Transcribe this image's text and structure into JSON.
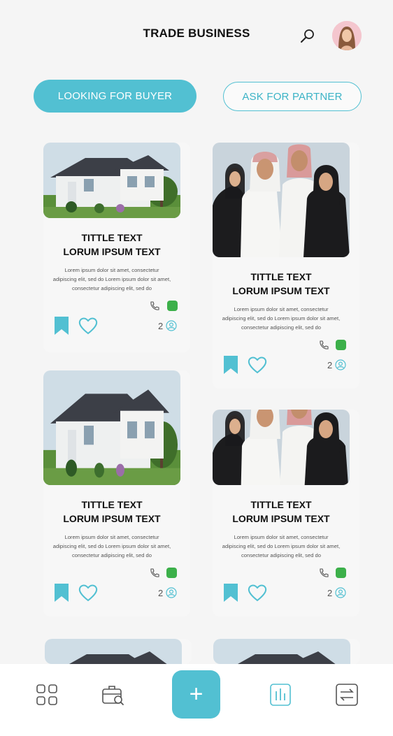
{
  "header": {
    "title": "TRADE BUSINESS",
    "search_icon": "search-icon",
    "avatar_icon": "user-avatar"
  },
  "tabs": [
    {
      "label": "LOOKING FOR BUYER",
      "active": true
    },
    {
      "label": "ASK FOR PARTNER",
      "active": false
    }
  ],
  "cards": [
    {
      "image": "house",
      "title_line1": "TITTLE TEXT",
      "title_line2": "LORUM IPSUM TEXT",
      "desc_line1": "Lorem ipsum dolor sit amet, consectetur",
      "desc_line2": "adipiscing elit, sed do Lorem ipsum dolor sit amet,",
      "desc_line3": "consectetur adipiscing elit, sed do",
      "count": "2"
    },
    {
      "image": "people",
      "title_line1": "TITTLE TEXT",
      "title_line2": "LORUM IPSUM TEXT",
      "desc_line1": "Lorem ipsum dolor sit amet, consectetur",
      "desc_line2": "adipiscing elit, sed do Lorem ipsum dolor sit amet,",
      "desc_line3": "consectetur adipiscing elit, sed do",
      "count": "2"
    },
    {
      "image": "house",
      "title_line1": "TITTLE TEXT",
      "title_line2": "LORUM IPSUM TEXT",
      "desc_line1": "Lorem ipsum dolor sit amet, consectetur",
      "desc_line2": "adipiscing elit, sed do Lorem ipsum dolor sit amet,",
      "desc_line3": "consectetur adipiscing elit, sed do",
      "count": "2"
    },
    {
      "image": "people",
      "title_line1": "TITTLE TEXT",
      "title_line2": "LORUM IPSUM TEXT",
      "desc_line1": "Lorem ipsum dolor sit amet, consectetur",
      "desc_line2": "adipiscing elit, sed do Lorem ipsum dolor sit amet,",
      "desc_line3": "consectetur adipiscing elit, sed do",
      "count": "2"
    }
  ],
  "bottom_nav": {
    "items": [
      "grid-icon",
      "briefcase-search-icon",
      "plus-icon",
      "chart-icon",
      "exchange-icon"
    ],
    "fab_label": "+"
  },
  "colors": {
    "accent": "#52c0d2",
    "whatsapp": "#3cb04a",
    "background": "#f5f5f5"
  }
}
